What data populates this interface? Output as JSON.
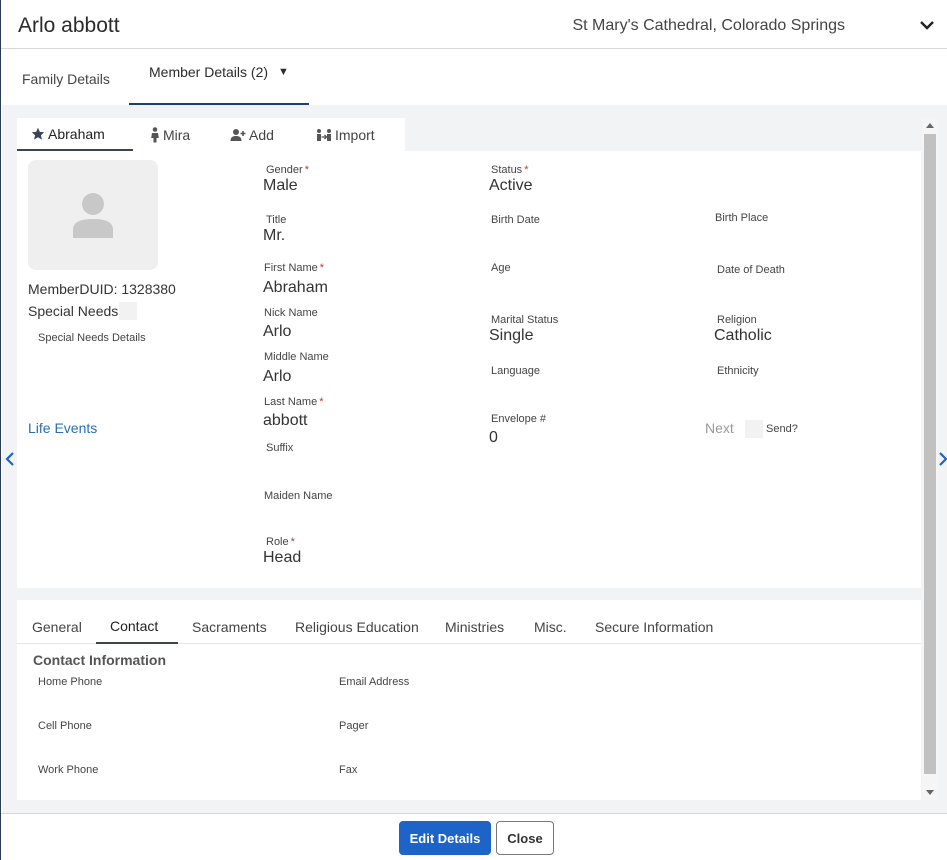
{
  "header": {
    "title": "Arlo abbott",
    "church": "St Mary's Cathedral, Colorado Springs"
  },
  "top_tabs": {
    "family": "Family Details",
    "member": "Member Details (2)",
    "member_caret": "▼"
  },
  "member_tabs": {
    "abraham": "Abraham",
    "mira": "Mira",
    "add": "Add",
    "import": "Import"
  },
  "profile": {
    "member_duid": "MemberDUID: 1328380",
    "special_needs": "Special Needs",
    "special_needs_details": "Special Needs Details",
    "life_events": "Life Events"
  },
  "fields": {
    "gender_label": "Gender",
    "gender_value": "Male",
    "status_label": "Status",
    "status_value": "Active",
    "title_label": "Title",
    "title_value": "Mr.",
    "birth_date_label": "Birth Date",
    "birth_place_label": "Birth Place",
    "first_name_label": "First Name",
    "first_name_value": "Abraham",
    "age_label": "Age",
    "date_of_death_label": "Date of Death",
    "nick_name_label": "Nick Name",
    "nick_name_value": "Arlo",
    "marital_status_label": "Marital Status",
    "marital_status_value": "Single",
    "religion_label": "Religion",
    "religion_value": "Catholic",
    "middle_name_label": "Middle Name",
    "middle_name_value": "Arlo",
    "language_label": "Language",
    "ethnicity_label": "Ethnicity",
    "last_name_label": "Last Name",
    "last_name_value": "abbott",
    "envelope_label": "Envelope #",
    "envelope_value": "0",
    "next_label": "Next",
    "send_label": "Send?",
    "suffix_label": "Suffix",
    "maiden_name_label": "Maiden Name",
    "role_label": "Role",
    "role_value": "Head",
    "required_mark": "*"
  },
  "sub_tabs": {
    "general": "General",
    "contact": "Contact",
    "sacraments": "Sacraments",
    "religious_education": "Religious Education",
    "ministries": "Ministries",
    "misc": "Misc.",
    "secure": "Secure Information"
  },
  "contact": {
    "title": "Contact Information",
    "home_phone": "Home Phone",
    "email_address": "Email Address",
    "cell_phone": "Cell Phone",
    "pager": "Pager",
    "work_phone": "Work Phone",
    "fax": "Fax"
  },
  "footer": {
    "edit": "Edit Details",
    "close": "Close"
  },
  "colors": {
    "primary_button": "#1e64c8",
    "tab_underline": "#1f3e74",
    "link": "#2a6db5",
    "required": "#c0392b"
  }
}
